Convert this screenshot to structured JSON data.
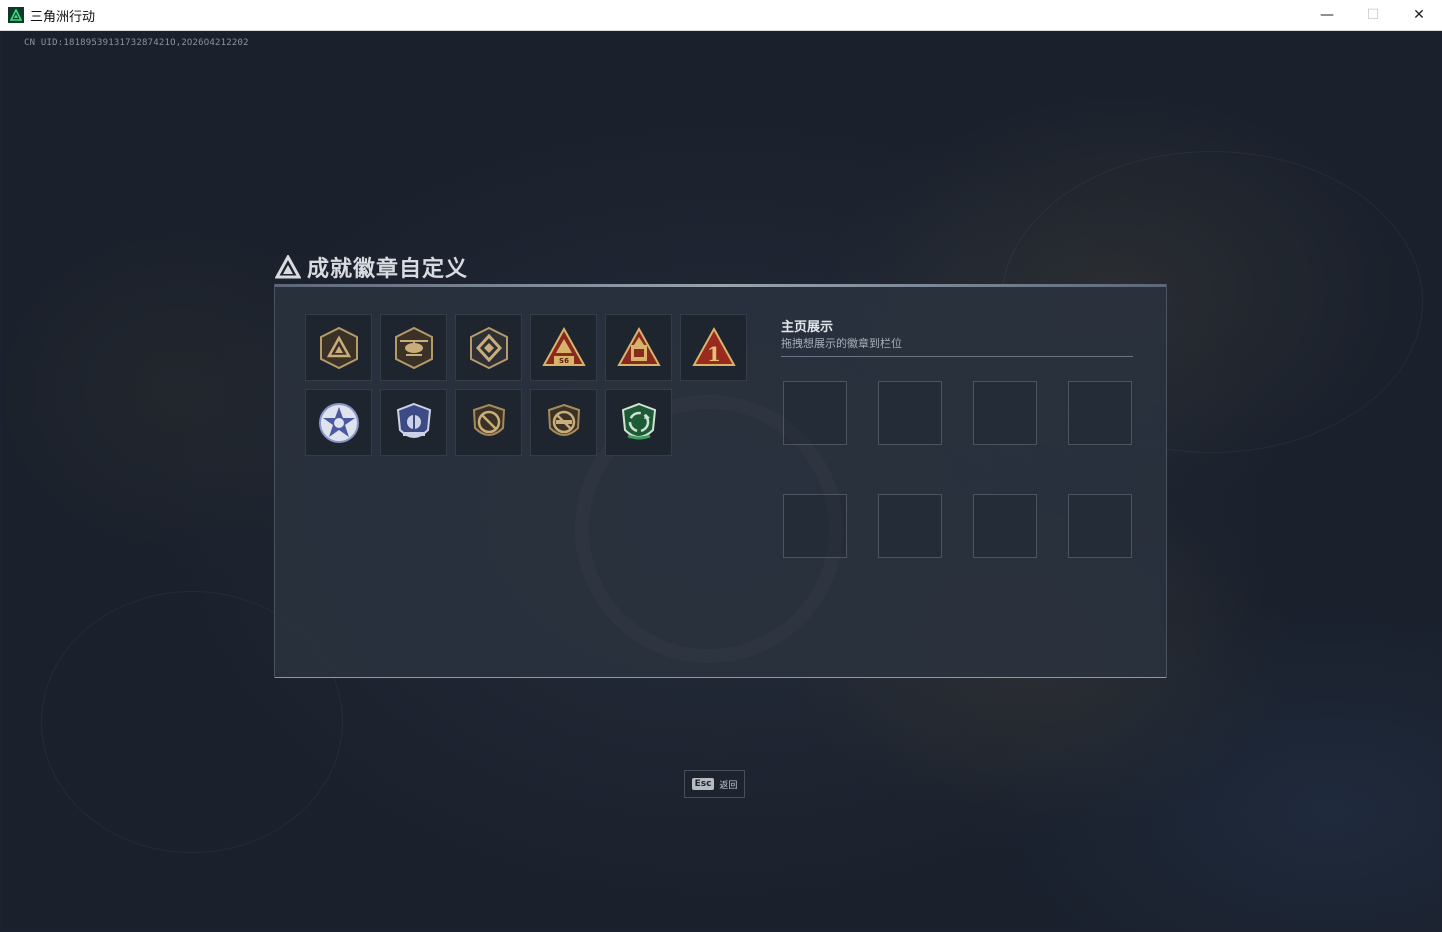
{
  "window": {
    "title": "三角洲行动",
    "minimize_glyph": "—",
    "maximize_glyph": "☐",
    "close_glyph": "✕"
  },
  "uid_text": "CN UID:1818953913173287421O,2O26O4212202",
  "panel": {
    "title": "成就徽章自定义"
  },
  "showcase": {
    "title": "主页展示",
    "subtitle": "拖拽想展示的徽章到栏位",
    "slot_count": 8
  },
  "badges": [
    {
      "icon": "shield-triangle-badge-icon",
      "color": "#b59a6a"
    },
    {
      "icon": "helicopter-badge-icon",
      "color": "#b59a6a"
    },
    {
      "icon": "diamond-emblem-badge-icon",
      "color": "#b59a6a"
    },
    {
      "icon": "s6-triangle-badge-icon",
      "color": "#c0392b",
      "label": "S6"
    },
    {
      "icon": "tower-triangle-badge-icon",
      "color": "#c0392b"
    },
    {
      "icon": "number-one-triangle-badge-icon",
      "color": "#c0392b",
      "label": "1"
    },
    {
      "icon": "star-police-badge-icon",
      "color": "#8a96c8"
    },
    {
      "icon": "police-shield-badge-icon",
      "color": "#6f7fb8"
    },
    {
      "icon": "no-weapon-shield-badge-icon",
      "color": "#a68a5a"
    },
    {
      "icon": "no-rifle-shield-badge-icon",
      "color": "#a68a5a"
    },
    {
      "icon": "green-recycle-badge-icon",
      "color": "#3f9b5a"
    }
  ],
  "footer": {
    "esc_key": "Esc",
    "esc_label": "返回"
  }
}
